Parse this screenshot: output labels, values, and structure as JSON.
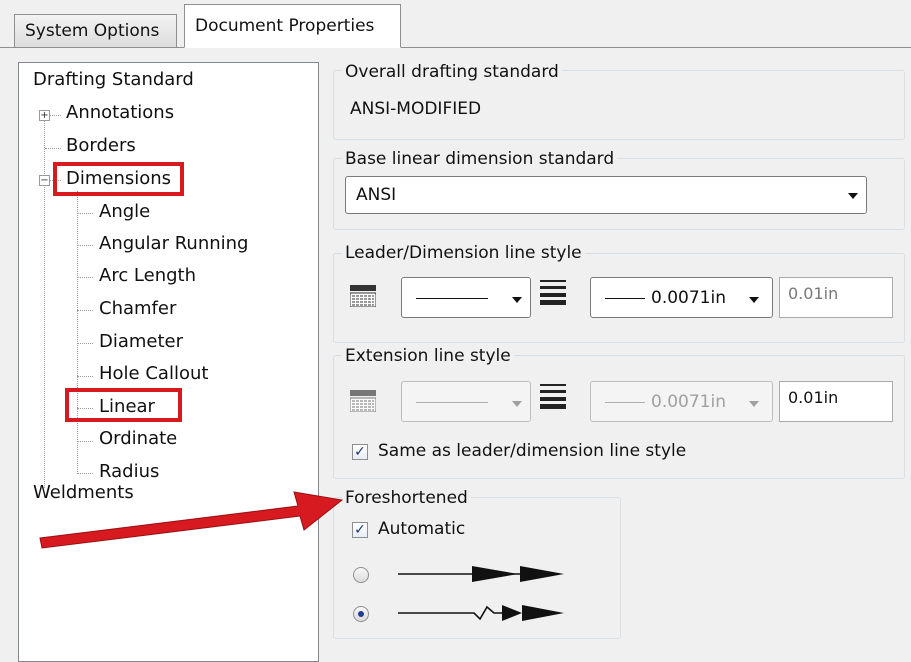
{
  "tabs": {
    "system_options": "System Options",
    "document_properties": "Document Properties"
  },
  "tree": {
    "root": "Drafting Standard",
    "annotations": "Annotations",
    "borders": "Borders",
    "dimensions": "Dimensions",
    "children": [
      "Angle",
      "Angular Running",
      "Arc Length",
      "Chamfer",
      "Diameter",
      "Hole Callout",
      "Linear",
      "Ordinate",
      "Radius"
    ],
    "weldments": "Weldments",
    "expander_plus": "+",
    "expander_minus": "−"
  },
  "overall": {
    "label": "Overall drafting standard",
    "value": "ANSI-MODIFIED"
  },
  "base_linear": {
    "label": "Base linear dimension standard",
    "value": "ANSI"
  },
  "leader_style": {
    "label": "Leader/Dimension line style",
    "thickness_value": "0.0071in",
    "custom_value": "0.01in"
  },
  "extension_style": {
    "label": "Extension line style",
    "thickness_value": "0.0071in",
    "custom_value": "0.01in",
    "same_as_label": "Same as leader/dimension line style",
    "same_as_checked": true
  },
  "foreshortened": {
    "label": "Foreshortened",
    "automatic_label": "Automatic",
    "automatic_checked": true,
    "selected_option": 2
  },
  "colors": {
    "highlight": "#d71920",
    "accent": "#1e3f8f"
  },
  "icons": [
    "line-font-icon",
    "line-thickness-icon",
    "chevron-down-icon",
    "checkmark-icon",
    "radio-icon",
    "arrow-icon"
  ]
}
